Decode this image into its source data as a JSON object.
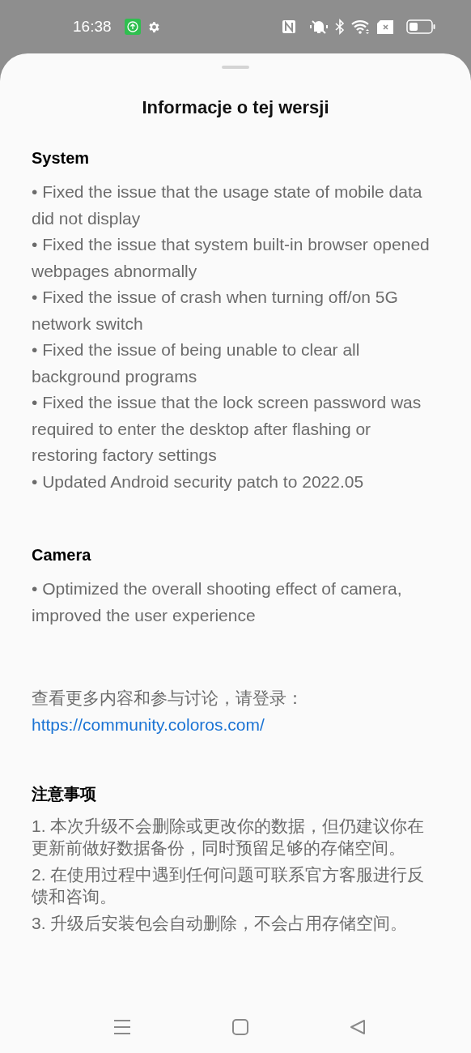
{
  "status_bar": {
    "time": "16:38"
  },
  "title": "Informacje o tej wersji",
  "sections": [
    {
      "heading": "System",
      "items": [
        "• Fixed the issue that the usage state of mobile data did not display",
        "• Fixed the issue that system built-in browser opened webpages abnormally",
        "• Fixed the issue of crash when turning off/on 5G network switch",
        "• Fixed the issue of being unable to clear all background programs",
        "• Fixed the issue that the lock screen password was required to enter the desktop after flashing or restoring factory settings",
        "• Updated Android security patch to 2022.05"
      ]
    },
    {
      "heading": "Camera",
      "items": [
        "• Optimized the overall shooting effect of camera, improved the user experience"
      ]
    }
  ],
  "more": {
    "text": "查看更多内容和参与讨论，请登录：",
    "link": "https://community.coloros.com/"
  },
  "notice": {
    "heading": "注意事项",
    "items": [
      "1. 本次升级不会删除或更改你的数据，但仍建议你在更新前做好数据备份，同时预留足够的存储空间。",
      "2. 在使用过程中遇到任何问题可联系官方客服进行反馈和咨询。",
      "3. 升级后安装包会自动删除，不会占用存储空间。"
    ]
  }
}
